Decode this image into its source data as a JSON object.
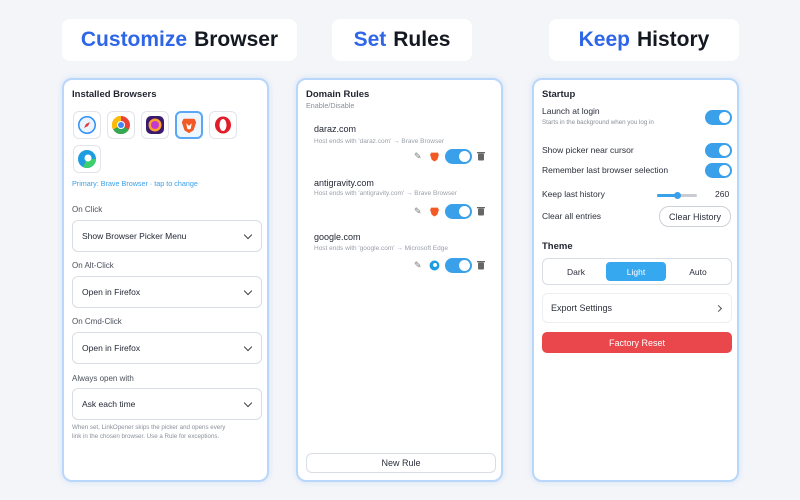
{
  "headlines": [
    {
      "accent": "Customize",
      "rest": "Browser"
    },
    {
      "accent": "Set",
      "rest": "Rules"
    },
    {
      "accent": "Keep",
      "rest": "History"
    }
  ],
  "browsers_panel": {
    "title": "Installed Browsers",
    "browsers": [
      {
        "name": "safari-icon",
        "color": "#2f8ef5"
      },
      {
        "name": "chrome-icon",
        "color": "#34a853"
      },
      {
        "name": "firefox-icon",
        "color": "#c13bd0"
      },
      {
        "name": "brave-icon",
        "color": "#f15a24",
        "selected": true
      },
      {
        "name": "opera-icon",
        "color": "#e11d2a"
      },
      {
        "name": "edge-icon",
        "color": "#1f9be0"
      }
    ],
    "primary_text": "Primary: Brave Browser · tap to change",
    "on_click_label": "On Click",
    "on_click_value": "Show Browser Picker Menu",
    "alt_click_label": "On Alt-Click",
    "alt_click_value": "Open in Firefox",
    "cmd_click_label": "On Cmd-Click",
    "cmd_click_value": "Open in Firefox",
    "always_label": "Always open with",
    "always_value": "Ask each time",
    "footnote_1": "When set, LinkOpener skips the picker and opens every",
    "footnote_2": "link in the chosen browser. Use a Rule for exceptions."
  },
  "rules_panel": {
    "title": "Domain Rules",
    "subtitle": "Enable/Disable",
    "rules": [
      {
        "domain": "daraz.com",
        "desc": "Host ends with 'daraz.com' → Brave Browser",
        "browser_color": "#f15a24",
        "enabled": true
      },
      {
        "domain": "antigravity.com",
        "desc": "Host ends with 'antigravity.com' → Brave Browser",
        "browser_color": "#f15a24",
        "enabled": true
      },
      {
        "domain": "google.com",
        "desc": "Host ends with 'google.com' → Microsoft Edge",
        "browser_color": "#1f9be0",
        "enabled": true
      }
    ],
    "new_rule_label": "New Rule"
  },
  "settings_panel": {
    "startup_title": "Startup",
    "launch_label": "Launch at login",
    "launch_sub": "Starts in the background when you log in",
    "launch_enabled": true,
    "picker_label": "Show picker near cursor",
    "picker_enabled": true,
    "remember_label": "Remember last browser selection",
    "remember_enabled": true,
    "history_label": "Keep last history",
    "history_value": "260",
    "history_fraction": 0.5,
    "clear_label": "Clear all entries",
    "clear_button": "Clear History",
    "theme_title": "Theme",
    "theme_options": [
      "Dark",
      "Light",
      "Auto"
    ],
    "theme_selected": "Light",
    "export_label": "Export Settings",
    "reset_label": "Factory Reset"
  }
}
